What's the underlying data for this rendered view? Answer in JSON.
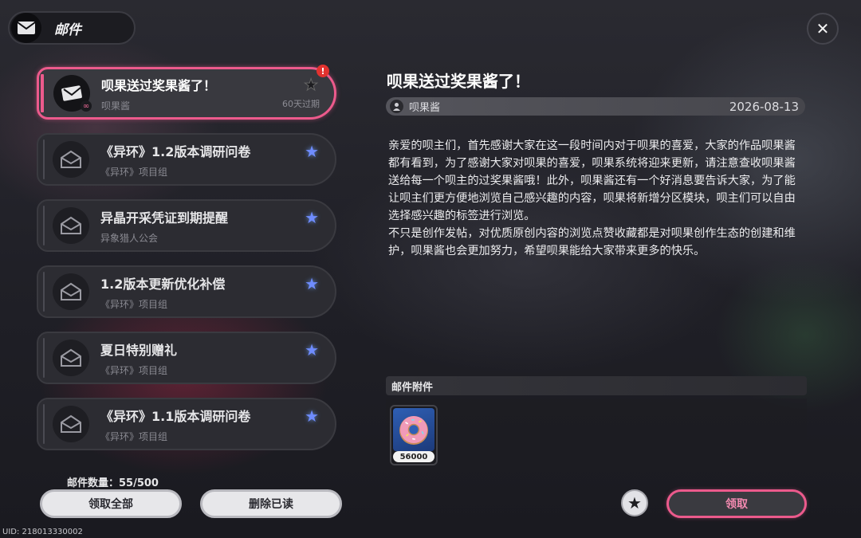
{
  "header": {
    "title": "邮件"
  },
  "mails": [
    {
      "title": "呗果送过奖果酱了！",
      "sender": "呗果酱",
      "expiry": "60天过期",
      "selected": true,
      "starred": false,
      "unread_alert": "!"
    },
    {
      "title": "《异环》1.2版本调研问卷",
      "sender": "《异环》项目组",
      "starred": true
    },
    {
      "title": "异晶开采凭证到期提醒",
      "sender": "异象猎人公会",
      "starred": true
    },
    {
      "title": "1.2版本更新优化补偿",
      "sender": "《异环》项目组",
      "starred": true
    },
    {
      "title": "夏日特别赠礼",
      "sender": "《异环》项目组",
      "starred": true
    },
    {
      "title": "《异环》1.1版本调研问卷",
      "sender": "《异环》项目组",
      "starred": true
    }
  ],
  "footer": {
    "mail_count": "邮件数量：55/500",
    "claim_all": "领取全部",
    "delete_read": "删除已读",
    "uid": "UID: 218013330002"
  },
  "detail": {
    "title": "呗果送过奖果酱了！",
    "sender": "呗果酱",
    "date": "2026-08-13",
    "body": [
      "亲爱的呗主们，首先感谢大家在这一段时间内对于呗果的喜爱，大家的作品呗果酱都有看到，为了感谢大家对呗果的喜爱，呗果系统将迎来更新，请注意查收呗果酱送给每一个呗主的过奖果酱哦！此外，呗果酱还有一个好消息要告诉大家，为了能让呗主们更方便地浏览自己感兴趣的内容，呗果将新增分区模块，呗主们可以自由选择感兴趣的标签进行浏览。",
      "不只是创作发帖，对优质原创内容的浏览点赞收藏都是对呗果创作生态的创建和维护，呗果酱也会更加努力，希望呗果能给大家带来更多的快乐。"
    ],
    "attachments_label": "邮件附件",
    "attachments": [
      {
        "icon": "donut-icon",
        "quantity": "56000"
      }
    ],
    "claim_label": "领取"
  },
  "colors": {
    "accent": "#ec5a8c",
    "star": "#6f8cff",
    "alert": "#e2322f"
  }
}
